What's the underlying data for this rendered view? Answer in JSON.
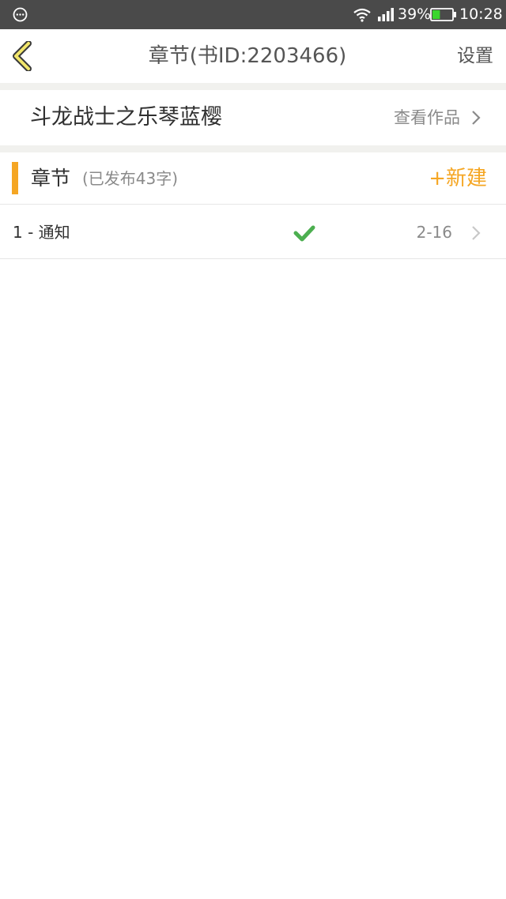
{
  "status_bar": {
    "battery_percent": "39%",
    "time": "10:28",
    "battery_level": 0.39,
    "icons": [
      "chat-icon",
      "wifi-icon",
      "signal-icon",
      "battery-icon"
    ]
  },
  "header": {
    "back_icon": "chevron-left-icon",
    "title": "章节(书ID:2203466)",
    "settings_label": "设置"
  },
  "book": {
    "title": "斗龙战士之乐琴蓝樱",
    "view_works_label": "查看作品"
  },
  "chapters_section": {
    "title": "章节",
    "subtitle": "(已发布43字)",
    "new_label": "+新建",
    "items": [
      {
        "name": "1 - 通知",
        "date": "2-16",
        "status_icon": "check-icon"
      }
    ]
  },
  "colors": {
    "accent": "#f5a623",
    "status_bar": "#4a4a4a",
    "check": "#4caf50",
    "divider": "#f1f1ee"
  }
}
